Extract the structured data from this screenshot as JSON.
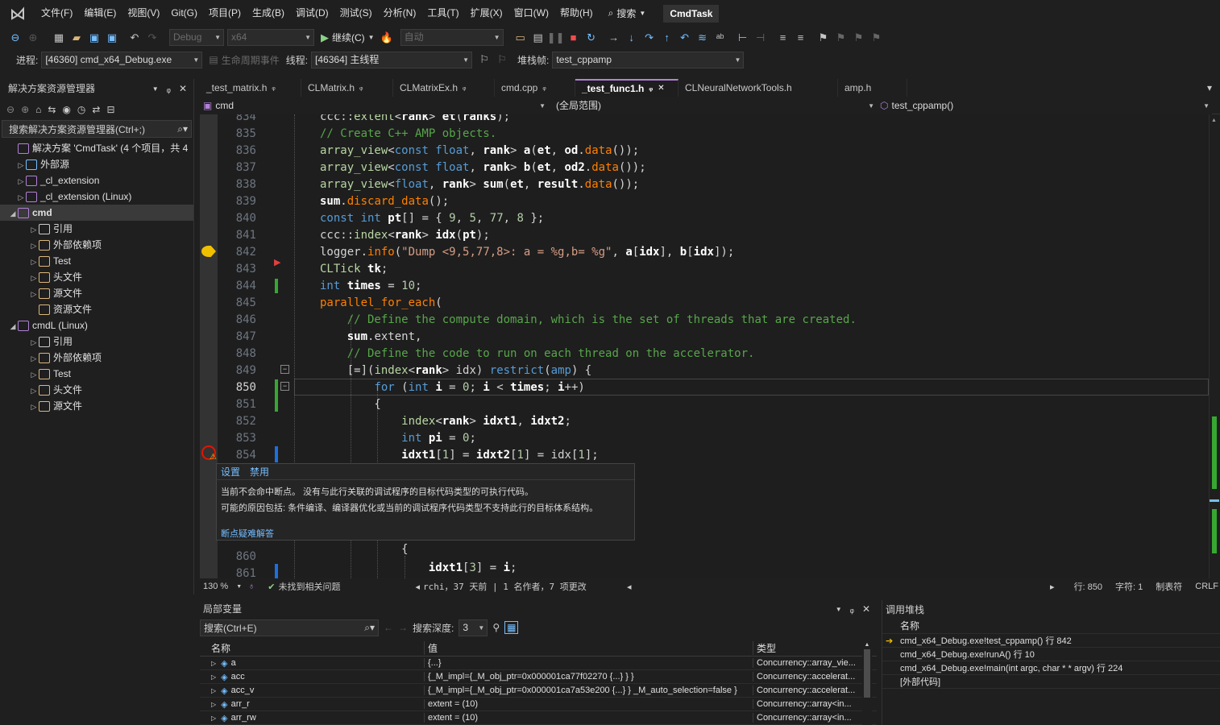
{
  "menu": [
    "文件(F)",
    "编辑(E)",
    "视图(V)",
    "Git(G)",
    "项目(P)",
    "生成(B)",
    "调试(D)",
    "测试(S)",
    "分析(N)",
    "工具(T)",
    "扩展(X)",
    "窗口(W)",
    "帮助(H)"
  ],
  "search_label": "搜索",
  "app_title": "CmdTask",
  "toolbar1": {
    "config": "Debug",
    "platform": "x64",
    "continue": "继续(C)",
    "auto": "自动"
  },
  "toolbar2": {
    "process_label": "进程:",
    "process_value": "[46360] cmd_x64_Debug.exe",
    "lifecycle": "生命周期事件",
    "thread_label": "线程:",
    "thread_value": "[46364] 主线程",
    "stackframe_label": "堆栈帧:",
    "stackframe_value": "test_cppamp"
  },
  "solution_explorer": {
    "title": "解决方案资源管理器",
    "search_placeholder": "搜索解决方案资源管理器(Ctrl+;)",
    "items": [
      {
        "label": "解决方案 'CmdTask' (4 个项目，共 4",
        "tri": ""
      },
      {
        "label": "外部源",
        "tri": "▷"
      },
      {
        "label": "_cl_extension",
        "tri": "▷"
      },
      {
        "label": "_cl_extension (Linux)",
        "tri": "▷"
      },
      {
        "label": "cmd",
        "tri": "◢"
      },
      {
        "label": "引用",
        "tri": "▷"
      },
      {
        "label": "外部依赖项",
        "tri": "▷"
      },
      {
        "label": "Test",
        "tri": "▷"
      },
      {
        "label": "头文件",
        "tri": "▷"
      },
      {
        "label": "源文件",
        "tri": "▷"
      },
      {
        "label": "资源文件",
        "tri": ""
      },
      {
        "label": "cmdL (Linux)",
        "tri": "◢"
      },
      {
        "label": "引用",
        "tri": "▷"
      },
      {
        "label": "外部依赖项",
        "tri": "▷"
      },
      {
        "label": "Test",
        "tri": "▷"
      },
      {
        "label": "头文件",
        "tri": "▷"
      },
      {
        "label": "源文件",
        "tri": "▷"
      }
    ]
  },
  "tabs": [
    "_test_matrix.h",
    "CLMatrix.h",
    "CLMatrixEx.h",
    "cmd.cpp",
    "_test_func1.h",
    "CLNeuralNetworkTools.h",
    "amp.h"
  ],
  "navbar": {
    "project": "cmd",
    "scope": "(全局范围)",
    "function": "test_cppamp()"
  },
  "line_numbers": [
    "834",
    "835",
    "836",
    "837",
    "838",
    "839",
    "840",
    "841",
    "842",
    "843",
    "844",
    "845",
    "846",
    "847",
    "848",
    "849",
    "850",
    "851",
    "852",
    "853",
    "854",
    "",
    "",
    "",
    "",
    "",
    "860",
    "861"
  ],
  "tooltip": {
    "link_settings": "设置",
    "link_disable": "禁用",
    "line1": "当前不会命中断点。 没有与此行关联的调试程序的目标代码类型的可执行代码。",
    "line2": "可能的原因包括: 条件编译、编译器优化或当前的调试程序代码类型不支持此行的目标体系结构。",
    "link_troubleshoot": "断点疑难解答"
  },
  "status": {
    "zoom": "130 %",
    "issues": "未找到相关问题",
    "git": "rchi，37 天前 | 1 名作者，7 项更改",
    "line": "行: 850",
    "col": "字符: 1",
    "tabs": "制表符",
    "eol": "CRLF"
  },
  "locals": {
    "title": "局部变量",
    "search_placeholder": "搜索(Ctrl+E)",
    "depth_label": "搜索深度:",
    "depth": "3",
    "col_name": "名称",
    "col_value": "值",
    "col_type": "类型",
    "rows": [
      {
        "name": "a",
        "value": "{...}",
        "type": "Concurrency::array_vie..."
      },
      {
        "name": "acc",
        "value": "{_M_impl={_M_obj_ptr=0x000001ca77f02270 {...} } }",
        "type": "Concurrency::accelerat..."
      },
      {
        "name": "acc_v",
        "value": "{_M_impl={_M_obj_ptr=0x000001ca7a53e200 {...} } _M_auto_selection=false }",
        "type": "Concurrency::accelerat..."
      },
      {
        "name": "arr_r",
        "value": "extent = (10)",
        "type": "Concurrency::array<in..."
      },
      {
        "name": "arr_rw",
        "value": "extent = (10)",
        "type": "Concurrency::array<in..."
      }
    ]
  },
  "callstack": {
    "title": "调用堆栈",
    "col_name": "名称",
    "rows": [
      "cmd_x64_Debug.exe!test_cppamp() 行 842",
      "cmd_x64_Debug.exe!runA() 行 10",
      "cmd_x64_Debug.exe!main(int argc, char * * argv) 行 224",
      "[外部代码]"
    ]
  }
}
